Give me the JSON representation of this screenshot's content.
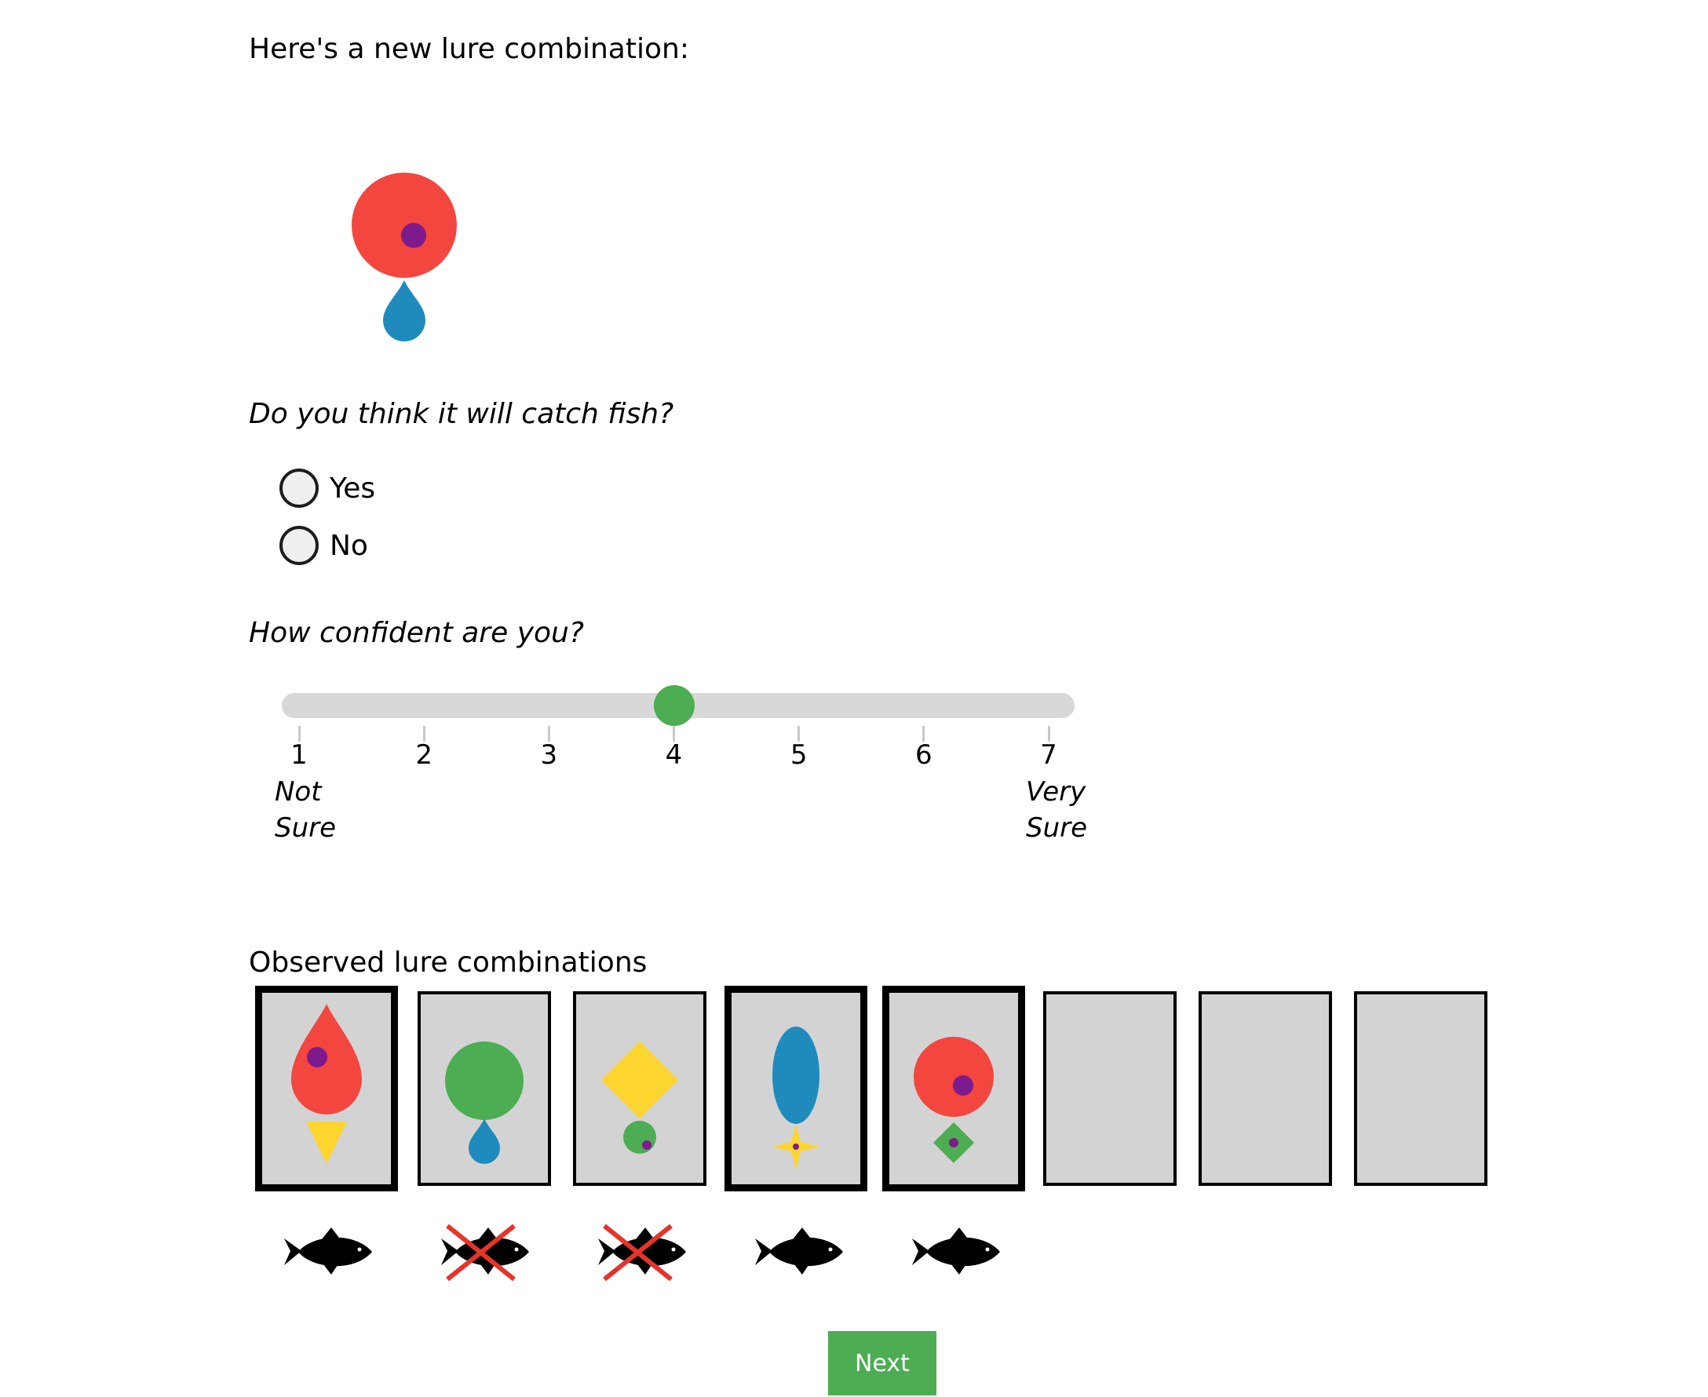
{
  "intro_text": "Here's a new lure combination:",
  "current_lure": {
    "top": "red circle with purple dot",
    "bottom": "blue drop"
  },
  "catch_question": "Do you think it will catch fish?",
  "catch_options": [
    "Yes",
    "No"
  ],
  "confidence_question": "How confident are you?",
  "confidence": {
    "min": 1,
    "max": 7,
    "value": 4,
    "tick_labels": [
      "1",
      "2",
      "3",
      "4",
      "5",
      "6",
      "7"
    ],
    "min_label_line1": "Not",
    "min_label_line2": "Sure",
    "max_label_line1": "Very",
    "max_label_line2": "Sure"
  },
  "observed_title": "Observed lure combinations",
  "observed": [
    {
      "lure": "red drop with purple dot + yellow triangle",
      "caught": true
    },
    {
      "lure": "green circle + blue drop",
      "caught": false
    },
    {
      "lure": "yellow diamond + green circle with purple dot",
      "caught": false
    },
    {
      "lure": "blue oval + yellow star",
      "caught": true
    },
    {
      "lure": "red circle with purple dot + green diamond",
      "caught": true
    },
    {
      "lure": "",
      "caught": null
    },
    {
      "lure": "",
      "caught": null
    },
    {
      "lure": "",
      "caught": null
    }
  ],
  "next_label": "Next",
  "colors": {
    "red": "#f2463f",
    "blue": "#1f8bbd",
    "green": "#4cad52",
    "yellow": "#fdd52f",
    "purple": "#7e1b8c",
    "card_bg": "#d3d3d3",
    "cross": "#e8332b"
  }
}
